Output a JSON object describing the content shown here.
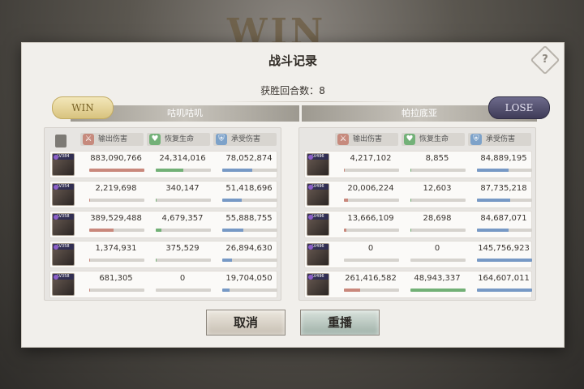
{
  "title": "战斗记录",
  "rounds_label": "获胜回合数：",
  "rounds_value": "8",
  "left_team": {
    "name": "咕叽咕叽",
    "result": "WIN"
  },
  "right_team": {
    "name": "帕拉底亚",
    "result": "LOSE"
  },
  "headers": {
    "damage": "输出伤害",
    "heal": "恢复生命",
    "received": "承受伤害"
  },
  "left_rows": [
    {
      "level": "LV384",
      "damage": "883,090,766",
      "heal": "24,314,016",
      "received": "78,052,874",
      "dmg_ratio": 1.0,
      "heal_ratio": 0.5,
      "recv_ratio": 0.54
    },
    {
      "level": "LV354",
      "damage": "2,219,698",
      "heal": "340,147",
      "received": "51,418,696",
      "dmg_ratio": 0.02,
      "heal_ratio": 0.01,
      "recv_ratio": 0.35
    },
    {
      "level": "LV358",
      "damage": "389,529,488",
      "heal": "4,679,357",
      "received": "55,888,755",
      "dmg_ratio": 0.44,
      "heal_ratio": 0.1,
      "recv_ratio": 0.38
    },
    {
      "level": "LV358",
      "damage": "1,374,931",
      "heal": "375,529",
      "received": "26,894,630",
      "dmg_ratio": 0.01,
      "heal_ratio": 0.01,
      "recv_ratio": 0.18
    },
    {
      "level": "LV358",
      "damage": "681,305",
      "heal": "0",
      "received": "19,704,050",
      "dmg_ratio": 0.01,
      "heal_ratio": 0.0,
      "recv_ratio": 0.13
    }
  ],
  "right_rows": [
    {
      "level": "LV496",
      "damage": "4,217,102",
      "heal": "8,855",
      "received": "84,889,195",
      "dmg_ratio": 0.02,
      "heal_ratio": 0.01,
      "recv_ratio": 0.58
    },
    {
      "level": "LV496",
      "damage": "20,006,224",
      "heal": "12,603",
      "received": "87,735,218",
      "dmg_ratio": 0.08,
      "heal_ratio": 0.01,
      "recv_ratio": 0.6
    },
    {
      "level": "LV496",
      "damage": "13,666,109",
      "heal": "28,698",
      "received": "84,687,071",
      "dmg_ratio": 0.05,
      "heal_ratio": 0.01,
      "recv_ratio": 0.58
    },
    {
      "level": "LV496",
      "damage": "0",
      "heal": "0",
      "received": "145,756,923",
      "dmg_ratio": 0.0,
      "heal_ratio": 0.0,
      "recv_ratio": 1.0
    },
    {
      "level": "LV496",
      "damage": "261,416,582",
      "heal": "48,943,337",
      "received": "164,607,011",
      "dmg_ratio": 0.3,
      "heal_ratio": 1.0,
      "recv_ratio": 1.0
    }
  ],
  "buttons": {
    "cancel": "取消",
    "replay": "重播"
  },
  "colors": {
    "damage": "#c9887c",
    "heal": "#72b076",
    "received": "#7799c5",
    "win_badge": "#d8c37f",
    "lose_badge": "#3f3c58"
  }
}
